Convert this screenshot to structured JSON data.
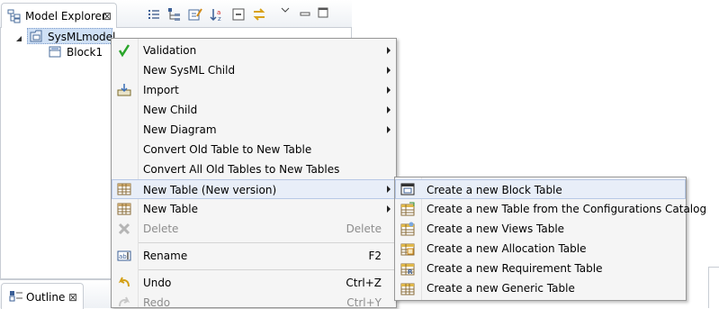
{
  "explorer": {
    "tab_title": "Model Explorer",
    "close_glyph": "⊠"
  },
  "tree": {
    "root_label": "SysMLmodel",
    "child_label": "Block1"
  },
  "context_menu": {
    "items": [
      {
        "label": "Validation",
        "icon": "checkmark-icon",
        "submenu": true
      },
      {
        "label": "New SysML Child",
        "submenu": true
      },
      {
        "label": "Import",
        "icon": "import-icon",
        "submenu": true
      },
      {
        "label": "New Child",
        "submenu": true
      },
      {
        "label": "New Diagram",
        "submenu": true
      },
      {
        "label": "Convert Old Table to New Table"
      },
      {
        "label": "Convert All Old Tables to New Tables"
      },
      {
        "label": "New Table (New version)",
        "icon": "table-icon",
        "submenu": true,
        "highlighted": true
      },
      {
        "label": "New Table",
        "icon": "table-icon",
        "submenu": true
      },
      {
        "label": "Delete",
        "icon": "delete-icon",
        "accelerator": "Delete",
        "disabled": true
      },
      {
        "label": "Rename",
        "icon": "rename-icon",
        "accelerator": "F2"
      },
      {
        "label": "Undo",
        "icon": "undo-icon",
        "accelerator": "Ctrl+Z"
      },
      {
        "label": "Redo",
        "icon": "redo-icon",
        "accelerator": "Ctrl+Y",
        "disabled": true
      }
    ]
  },
  "submenu": {
    "items": [
      {
        "label": "Create a new Block Table",
        "icon": "block-table-icon",
        "highlighted": true
      },
      {
        "label": "Create a new Table from the Configurations Catalog",
        "icon": "catalog-table-icon"
      },
      {
        "label": "Create a new Views Table",
        "icon": "views-table-icon"
      },
      {
        "label": "Create a new Allocation Table",
        "icon": "allocation-table-icon"
      },
      {
        "label": "Create a new Requirement Table",
        "icon": "requirement-table-icon"
      },
      {
        "label": "Create a new Generic Table",
        "icon": "generic-table-icon"
      }
    ]
  },
  "outline": {
    "tab_title": "Outline",
    "close_glyph": "⊠"
  },
  "colors": {
    "menu_bg": "#f5f5f5",
    "highlight": "#e8eef8",
    "disabled_text": "#8d8d8d",
    "check_green": "#2aa52a"
  }
}
